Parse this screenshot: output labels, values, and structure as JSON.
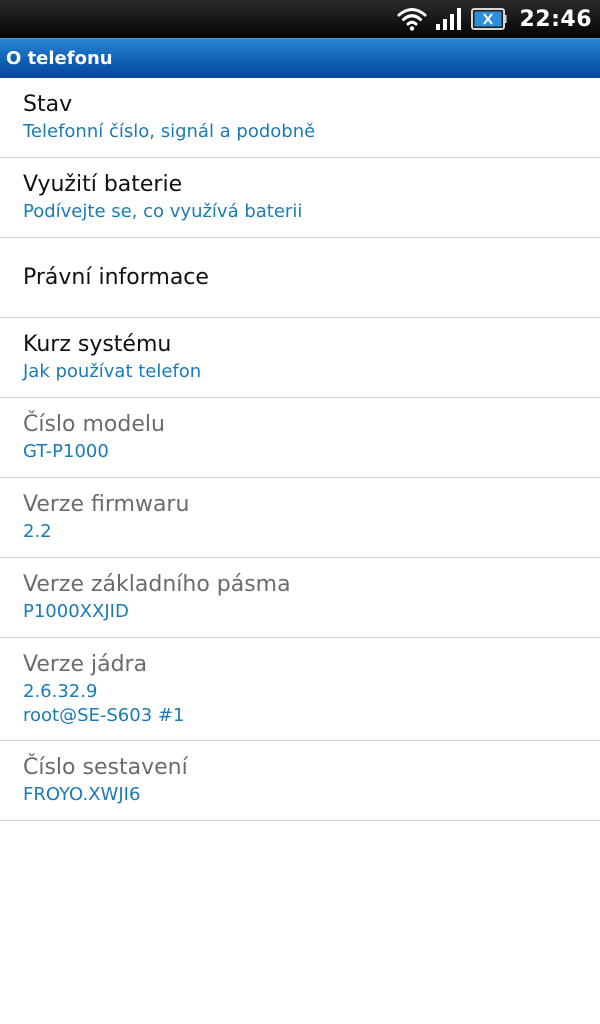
{
  "status_bar": {
    "time": "22:46",
    "icons": [
      "wifi-icon",
      "signal-icon",
      "battery-charging-icon"
    ]
  },
  "header": {
    "title": "O telefonu"
  },
  "items": [
    {
      "label": "Stav",
      "sub": "Telefonní číslo, signál a podobně"
    },
    {
      "label": "Využití baterie",
      "sub": "Podívejte se, co využívá baterii"
    },
    {
      "label": "Právní informace"
    },
    {
      "label": "Kurz systému",
      "sub": "Jak používat telefon"
    },
    {
      "label": "Číslo modelu",
      "sub": "GT-P1000"
    },
    {
      "label": "Verze firmwaru",
      "sub": "2.2"
    },
    {
      "label": "Verze základního pásma",
      "sub": "P1000XXJID"
    },
    {
      "label": "Verze jádra",
      "sub": "2.6.32.9",
      "sub2": "root@SE-S603 #1"
    },
    {
      "label": "Číslo sestavení",
      "sub": "FROYO.XWJI6"
    }
  ],
  "colors": {
    "accent": "#1a7bb8",
    "title_bar": "#0f5fb3",
    "status_bar": "#000000"
  }
}
